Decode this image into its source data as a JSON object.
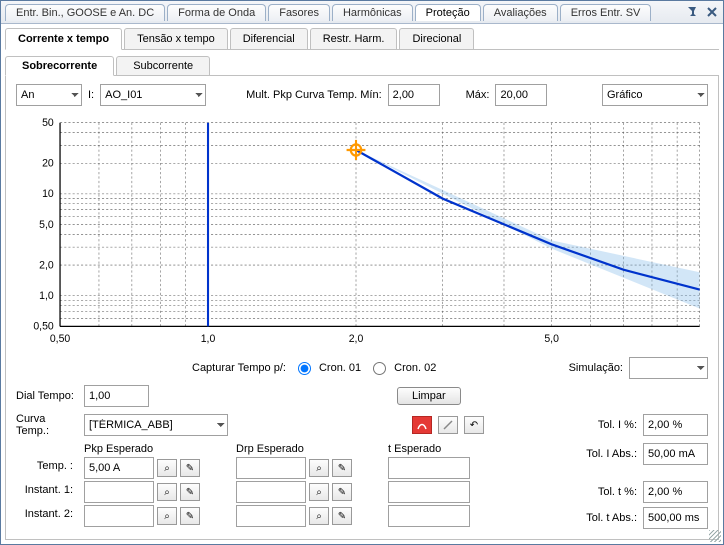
{
  "outer_tabs": {
    "t0": "Entr. Bin., GOOSE e An. DC",
    "t1": "Forma de Onda",
    "t2": "Fasores",
    "t3": "Harmônicas",
    "t4": "Proteção",
    "t5": "Avaliações",
    "t6": "Erros Entr. SV"
  },
  "inner_tabs": {
    "t0": "Corrente x tempo",
    "t1": "Tensão x tempo",
    "t2": "Diferencial",
    "t3": "Restr. Harm.",
    "t4": "Direcional"
  },
  "sub_tabs": {
    "t0": "Sobrecorrente",
    "t1": "Subcorrente"
  },
  "topbar": {
    "anode": "An",
    "i_label": "I:",
    "i_value": "AO_I01",
    "mult_label": "Mult. Pkp Curva Temp. Mín:",
    "mult_min": "2,00",
    "mult_max_label": "Máx:",
    "mult_max": "20,00",
    "view_label": "Gráfico"
  },
  "capture": {
    "label": "Capturar Tempo p/:",
    "opt1": "Cron. 01",
    "opt2": "Cron. 02",
    "sim_label": "Simulação:",
    "sim_value": ""
  },
  "dial": {
    "label": "Dial Tempo:",
    "value": "1,00",
    "clear": "Limpar"
  },
  "curve": {
    "label": "Curva Temp.:",
    "value": "[TÉRMICA_ABB]"
  },
  "cols": {
    "pkp": "Pkp Esperado",
    "drp": "Drp Esperado",
    "t": "t Esperado"
  },
  "rows": {
    "temp": "Temp. :",
    "inst1": "Instant. 1:",
    "inst2": "Instant. 2:",
    "temp_pkp": "5,00 A"
  },
  "tol": {
    "i_pct_label": "Tol. I %:",
    "i_pct": "2,00 %",
    "i_abs_label": "Tol. I Abs.:",
    "i_abs": "50,00 mA",
    "t_pct_label": "Tol. t %:",
    "t_pct": "2,00 %",
    "t_abs_label": "Tol. t Abs.:",
    "t_abs": "500,00 ms"
  },
  "chart_data": {
    "type": "line",
    "xscale": "log",
    "yscale": "log",
    "xlim": [
      0.5,
      10
    ],
    "ylim": [
      0.5,
      50
    ],
    "xticks": [
      0.5,
      1.0,
      2.0,
      5.0
    ],
    "yticks": [
      0.5,
      1.0,
      2.0,
      5.0,
      10,
      20,
      50
    ],
    "xticklabels": [
      "0,50",
      "1,0",
      "2,0",
      "5,0"
    ],
    "yticklabels": [
      "0,50",
      "1,0",
      "2,0",
      "5,0",
      "10",
      "20",
      "50"
    ],
    "series": [
      {
        "name": "curve",
        "x": [
          2.0,
          3.0,
          5.0,
          7.0,
          10.0
        ],
        "y": [
          27,
          9,
          3.2,
          1.8,
          1.15
        ]
      }
    ],
    "vline_x": 1.0,
    "marker": {
      "x": 2.0,
      "y": 27
    },
    "tolerance": [
      {
        "x": 2.0,
        "ylow": 27,
        "yhigh": 27
      },
      {
        "x": 5.0,
        "ylow": 2.9,
        "yhigh": 3.5
      },
      {
        "x": 10.0,
        "ylow": 0.75,
        "yhigh": 1.7
      }
    ]
  }
}
